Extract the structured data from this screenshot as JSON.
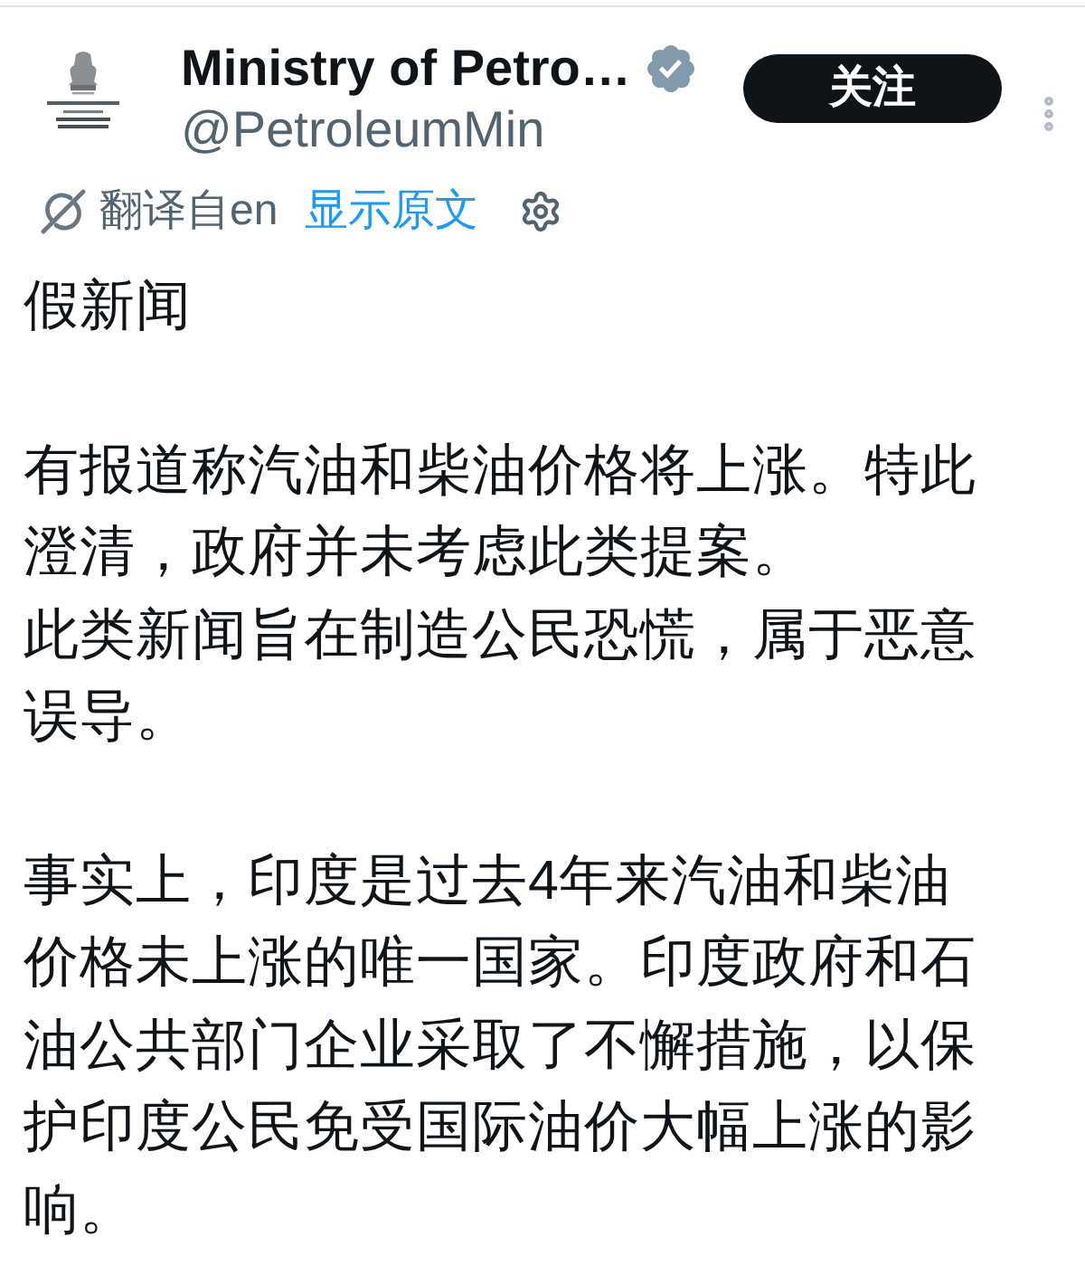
{
  "account": {
    "name": "Ministry of Petro…",
    "verified": true,
    "handle": "@PetroleumMin",
    "follow_button": "关注"
  },
  "translation": {
    "source": "翻译自en",
    "show_original": "显示原文"
  },
  "body": [
    {
      "lines": [
        "假新闻"
      ]
    },
    {
      "lines": [
        "有报道称汽油和柴油价格将上涨。特此",
        "澄清，政府并未考虑此类提案。",
        "此类新闻旨在制造公民恐慌，属于恶意",
        "误导。"
      ]
    },
    {
      "lines": [
        "事实上，印度是过去4年来汽油和柴油",
        "价格未上涨的唯一国家。印度政府和石",
        "油公共部门企业采取了不懈措施，以保",
        "护印度公民免受国际油价大幅上涨的影",
        "响。"
      ]
    }
  ]
}
